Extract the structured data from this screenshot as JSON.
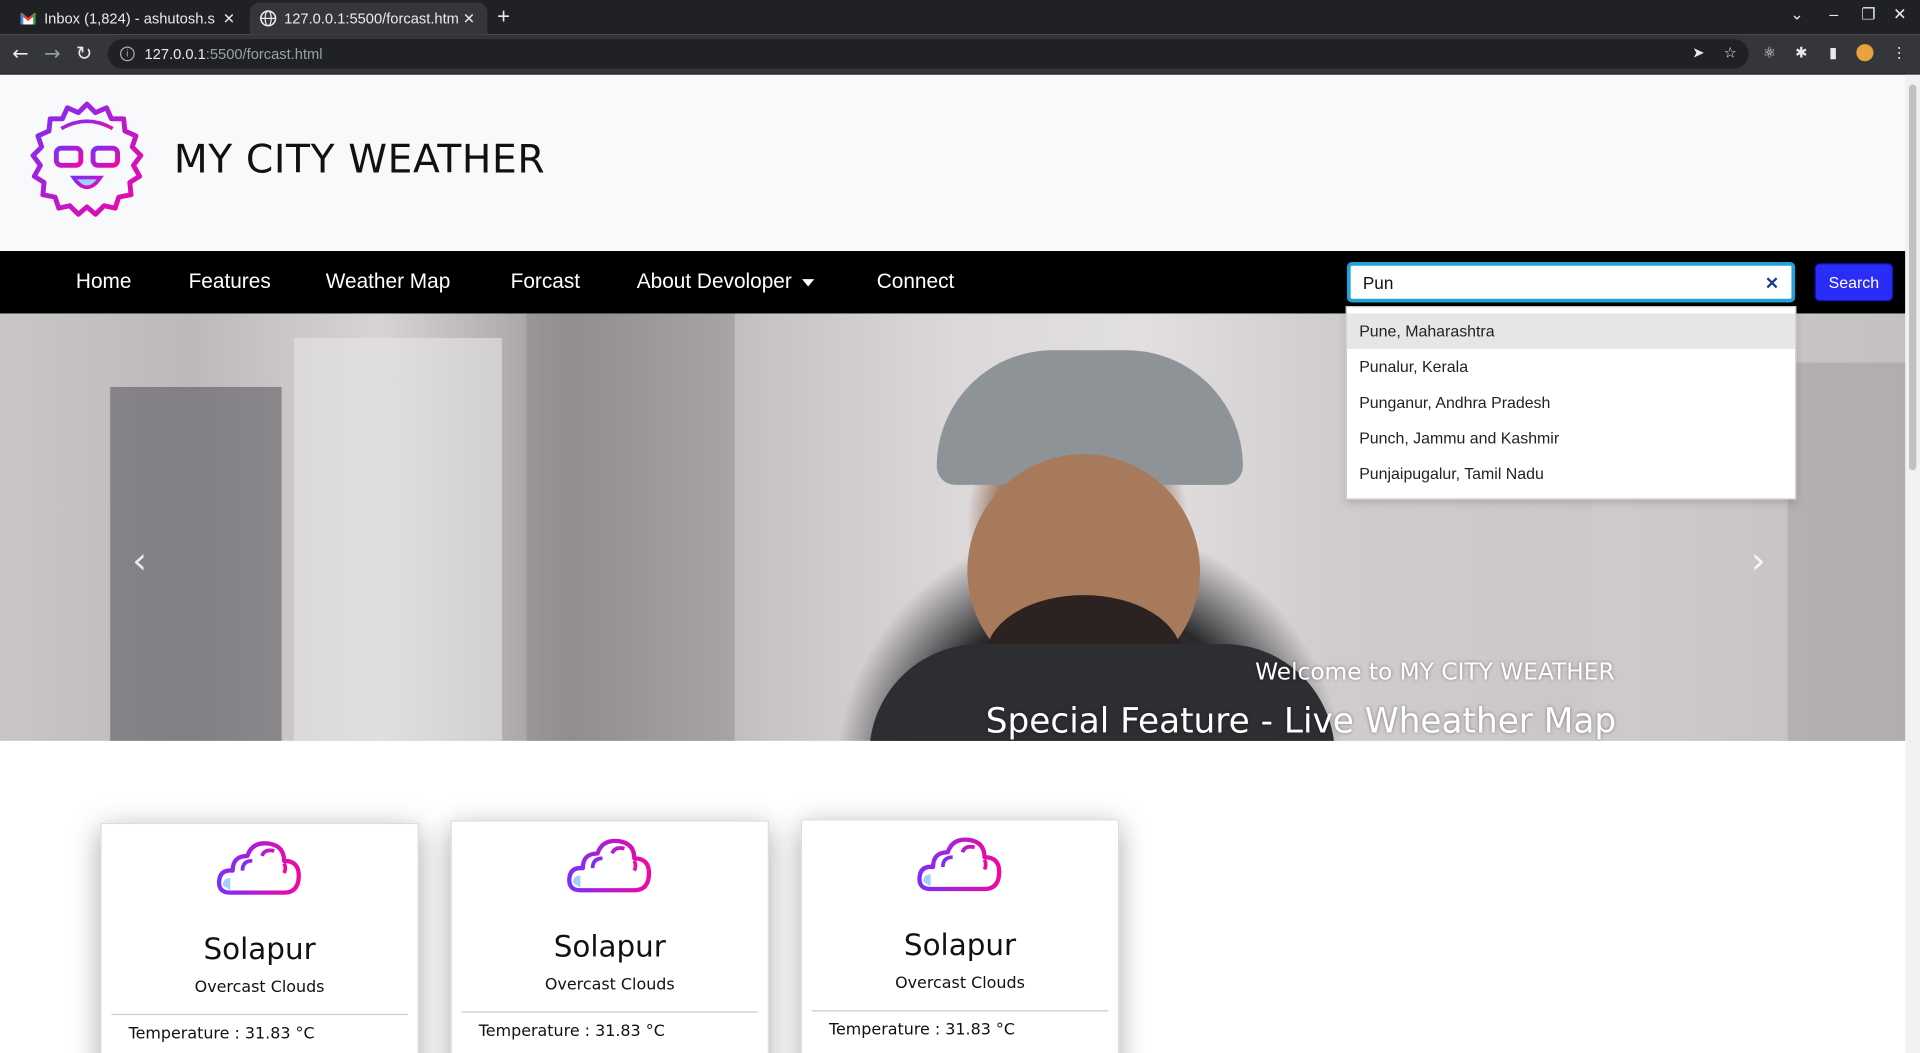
{
  "browser": {
    "tabs": [
      {
        "title": "Inbox (1,824) - ashutosh.s",
        "active": false,
        "icon": "gmail-icon"
      },
      {
        "title": "127.0.0.1:5500/forcast.htm",
        "active": true,
        "icon": "globe-icon"
      }
    ],
    "new_tab": "+",
    "url_host": "127.0.0.1",
    "url_path": ":5500/forcast.html"
  },
  "site": {
    "brand_title": "MY CITY WEATHER"
  },
  "nav": {
    "items": [
      "Home",
      "Features",
      "Weather Map",
      "Forcast",
      "About Devoloper",
      "Connect"
    ],
    "search_value": "Pun",
    "search_button": "Search"
  },
  "suggestions": [
    "Pune, Maharashtra",
    "Punalur, Kerala",
    "Punganur, Andhra Pradesh",
    "Punch, Jammu and Kashmir",
    "Punjaipugalur, Tamil Nadu"
  ],
  "hero": {
    "caption_small": "Welcome to MY CITY WEATHER",
    "caption_large": "Special Feature - Live Wheather Map"
  },
  "cards": [
    {
      "city": "Solapur",
      "desc": "Overcast Clouds",
      "temp": "Temperature : 31.83 °C"
    },
    {
      "city": "Solapur",
      "desc": "Overcast Clouds",
      "temp": "Temperature : 31.83 °C"
    },
    {
      "city": "Solapur",
      "desc": "Overcast Clouds",
      "temp": "Temperature : 31.83 °C"
    }
  ],
  "colors": {
    "accent": "#2a2cf7",
    "logo_gradient_start": "#7b2ff7",
    "logo_gradient_end": "#f107a3"
  }
}
